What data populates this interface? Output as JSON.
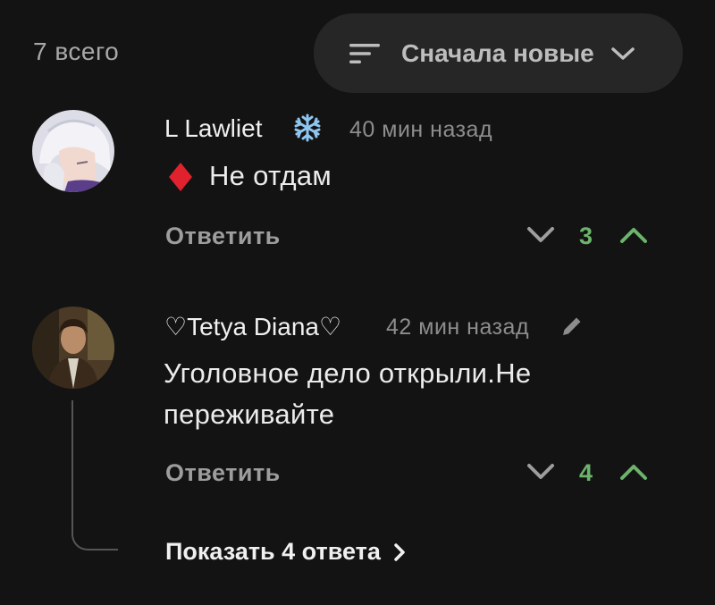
{
  "header": {
    "total_label": "7 всего",
    "sort_label": "Сначала новые"
  },
  "comments": [
    {
      "username": "L Lawliet",
      "name_emoji": "❄️",
      "time": "40 мин назад",
      "text_emoji": "♦️",
      "text": "Не отдам",
      "reply_label": "Ответить",
      "votes": "3"
    },
    {
      "username": "♡Tetya Diana♡",
      "time": "42 мин назад",
      "text_lines": [
        "Уголовное дело открыли.Не",
        "переживайте"
      ],
      "reply_label": "Ответить",
      "votes": "4",
      "show_replies_label": "Показать 4 ответа"
    }
  ],
  "colors": {
    "background": "#131313",
    "vote_positive": "#6cb36b",
    "sort_pill": "#262626"
  },
  "icons": {
    "sort": "sort-icon",
    "chevron": "chevron-down-icon",
    "snowflake": "snowflake-icon",
    "diamond": "red-diamond-icon",
    "edit": "pencil-icon",
    "downvote": "chevron-down-icon",
    "upvote": "chevron-up-icon",
    "show_more": "chevron-right-icon"
  }
}
